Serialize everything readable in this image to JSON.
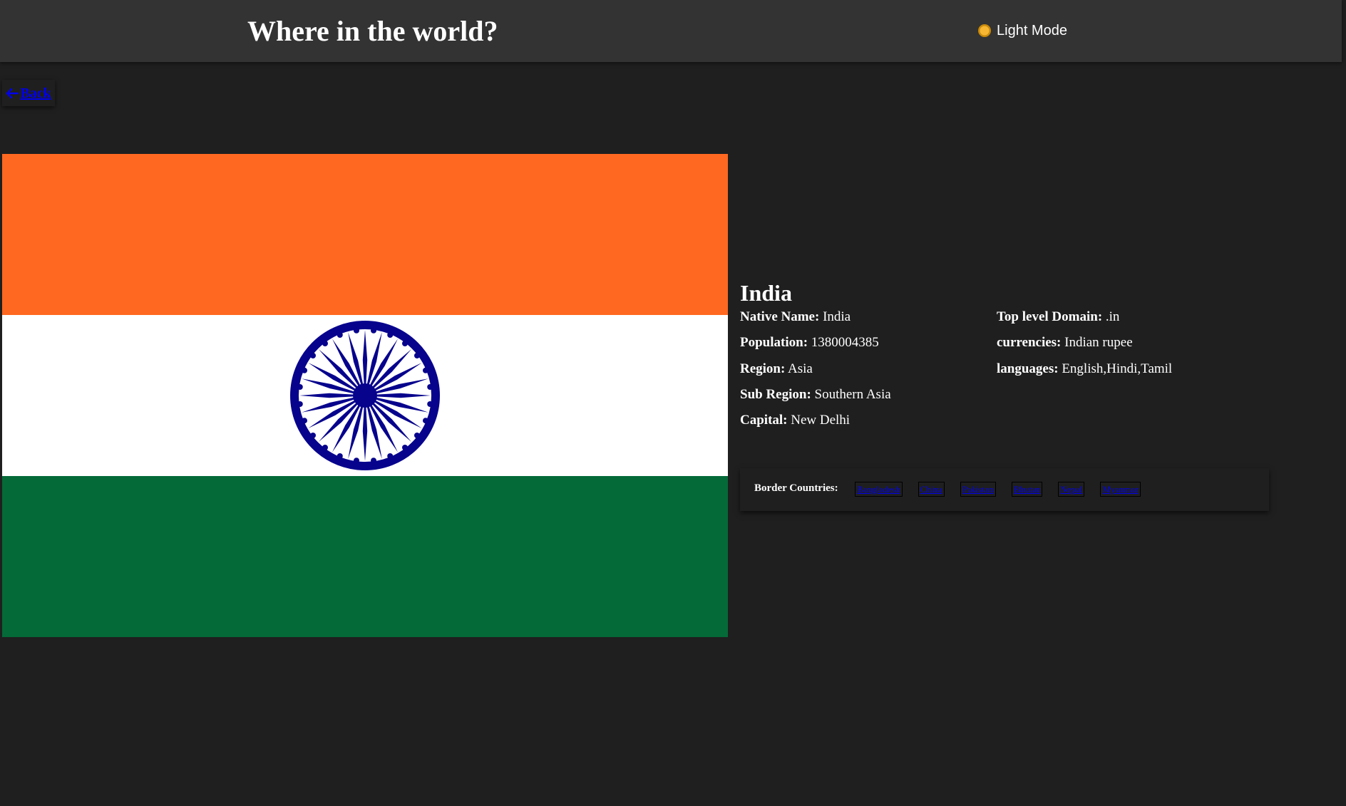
{
  "header": {
    "title": "Where in the world?",
    "mode_toggle_label": "Light Mode",
    "mode_icon": "sun-icon"
  },
  "back": {
    "label": "Back",
    "icon": "arrow-left-icon"
  },
  "flag": {
    "country": "India",
    "colors": {
      "top": "#FF6820",
      "middle": "#FFFFFF",
      "bottom": "#046A38",
      "chakra": "#07038D"
    }
  },
  "country": {
    "name": "India",
    "details_left": [
      {
        "label": "Native Name:",
        "value": "India"
      },
      {
        "label": "Population:",
        "value": "1380004385"
      },
      {
        "label": "Region:",
        "value": "Asia"
      },
      {
        "label": "Sub Region:",
        "value": "Southern Asia"
      },
      {
        "label": "Capital:",
        "value": "New Delhi"
      }
    ],
    "details_right": [
      {
        "label": "Top level Domain:",
        "value": ".in"
      },
      {
        "label": "currencies:",
        "value": "Indian rupee"
      },
      {
        "label": "languages:",
        "value": "English,Hindi,Tamil"
      }
    ]
  },
  "borders": {
    "label": "Border Countries:",
    "countries": [
      "Bangladesh",
      "China",
      "Pakistan",
      "Bhutan",
      "Nepal",
      "Myanmar"
    ]
  },
  "theme": {
    "background": "#1F1F1F",
    "header_background": "#333333",
    "text": "#FFFFFF",
    "link": "#0000EE"
  }
}
